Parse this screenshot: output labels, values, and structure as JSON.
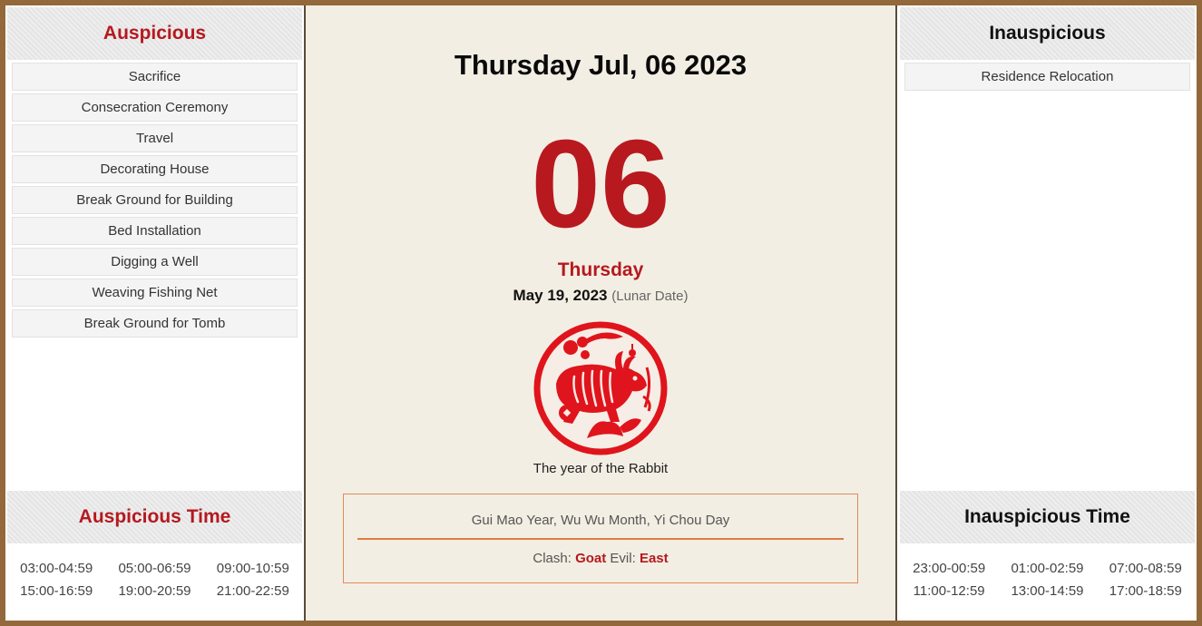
{
  "auspicious": {
    "title": "Auspicious",
    "items": [
      "Sacrifice",
      "Consecration Ceremony",
      "Travel",
      "Decorating House",
      "Break Ground for Building",
      "Bed Installation",
      "Digging a Well",
      "Weaving Fishing Net",
      "Break Ground for Tomb"
    ]
  },
  "auspicious_time": {
    "title": "Auspicious Time",
    "slots": [
      "03:00-04:59",
      "05:00-06:59",
      "09:00-10:59",
      "15:00-16:59",
      "19:00-20:59",
      "21:00-22:59"
    ]
  },
  "inauspicious": {
    "title": "Inauspicious",
    "items": [
      "Residence Relocation"
    ]
  },
  "inauspicious_time": {
    "title": "Inauspicious Time",
    "slots": [
      "23:00-00:59",
      "01:00-02:59",
      "07:00-08:59",
      "11:00-12:59",
      "13:00-14:59",
      "17:00-18:59"
    ]
  },
  "center": {
    "full_date": "Thursday Jul, 06 2023",
    "day_number": "06",
    "weekday": "Thursday",
    "lunar_date": "May 19, 2023",
    "lunar_label": "(Lunar Date)",
    "zodiac_icon": "rabbit-papercut-icon",
    "zodiac_caption": "The year of the Rabbit",
    "ganzhi": "Gui Mao Year, Wu Wu Month, Yi Chou Day",
    "clash_label": "Clash:",
    "clash_value": "Goat",
    "evil_label": "Evil:",
    "evil_value": "East"
  },
  "colors": {
    "frame": "#93683a",
    "accent_red": "#b5191f",
    "center_bg": "#f3eee3",
    "box_border": "#e08a5a"
  }
}
